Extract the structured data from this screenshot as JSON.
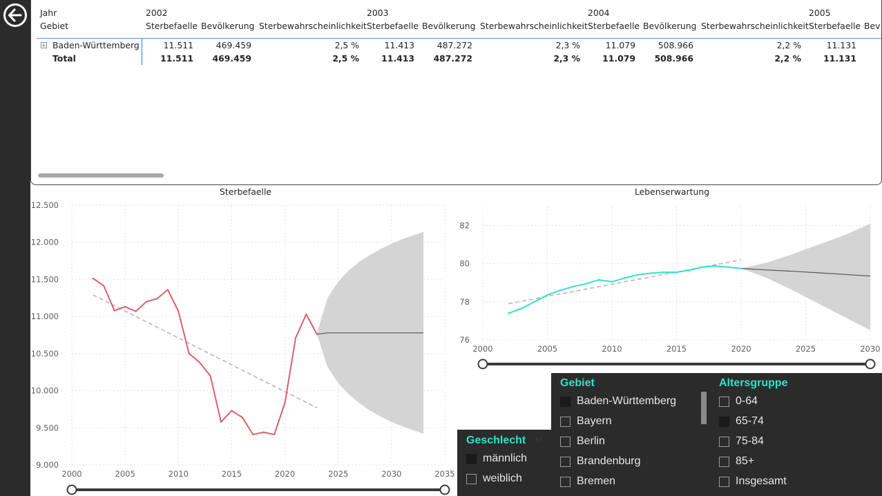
{
  "table": {
    "row_header_year": "Jahr",
    "row_header_area": "Gebiet",
    "years": [
      {
        "year": "2002",
        "cols": [
          "Sterbefaelle",
          "Bevölkerung",
          "Sterbewahrscheinlichkeit"
        ],
        "row": [
          "11.511",
          "469.459",
          "2,5 %"
        ],
        "total": [
          "11.511",
          "469.459",
          "2,5 %"
        ]
      },
      {
        "year": "2003",
        "cols": [
          "Sterbefaelle",
          "Bevölkerung",
          "Sterbewahrscheinlichkeit"
        ],
        "row": [
          "11.413",
          "487.272",
          "2,3 %"
        ],
        "total": [
          "11.413",
          "487.272",
          "2,3 %"
        ]
      },
      {
        "year": "2004",
        "cols": [
          "Sterbefaelle",
          "Bevölkerung",
          "Sterbewahrscheinlichkeit"
        ],
        "row": [
          "11.079",
          "508.966",
          "2,2 %"
        ],
        "total": [
          "11.079",
          "508.966",
          "2,2 %"
        ]
      },
      {
        "year": "2005",
        "cols": [
          "Sterbefaelle",
          "Bev"
        ],
        "row": [
          "11.131"
        ],
        "total": [
          "11.131"
        ]
      }
    ],
    "row_label": "Baden-Württemberg",
    "total_label": "Total"
  },
  "icons": {
    "back": "circle-arrow-left-icon",
    "expand": "plus-square-icon",
    "dropdown": "chevron-down-icon"
  },
  "chart_data": [
    {
      "type": "line",
      "title": "Sterbefaelle",
      "xlabel": "",
      "ylabel": "",
      "xlim": [
        2000,
        2035
      ],
      "ylim": [
        9000,
        12500
      ],
      "xticks": [
        2000,
        2005,
        2010,
        2015,
        2020,
        2025,
        2030,
        2035
      ],
      "xtick_labels": [
        "2000",
        "2005",
        "2010",
        "2015",
        "2020",
        "2025",
        "2030",
        "2035"
      ],
      "yticks": [
        9000,
        9500,
        10000,
        10500,
        11000,
        11500,
        12000,
        12500
      ],
      "ytick_labels": [
        "9.000",
        "9.500",
        "10.000",
        "10.500",
        "11.000",
        "11.500",
        "12.000",
        "12.500"
      ],
      "grid": true,
      "series": [
        {
          "color": "#d9606b",
          "x": [
            2002,
            2003,
            2004,
            2005,
            2006,
            2007,
            2008,
            2009,
            2010,
            2011,
            2012,
            2013,
            2014,
            2015,
            2016,
            2017,
            2018,
            2019,
            2020,
            2021,
            2022,
            2023
          ],
          "y": [
            11511,
            11413,
            11079,
            11131,
            11070,
            11200,
            11240,
            11360,
            11070,
            10500,
            10380,
            10200,
            9580,
            9730,
            9640,
            9410,
            9440,
            9410,
            9840,
            10710,
            11030,
            10760
          ]
        }
      ],
      "trend": {
        "color": "#bdbdbd",
        "x": [
          2002,
          2023
        ],
        "y": [
          11290,
          9770
        ]
      },
      "forecast": {
        "color": "#555555",
        "band_color": "#d4d4d4",
        "x": [
          2023,
          2024,
          2025,
          2026,
          2027,
          2028,
          2029,
          2030,
          2031,
          2032,
          2033
        ],
        "y": [
          10760,
          10780,
          10780,
          10780,
          10780,
          10780,
          10780,
          10780,
          10780,
          10780,
          10780
        ],
        "upper": [
          10780,
          11250,
          11470,
          11620,
          11740,
          11830,
          11910,
          11980,
          12040,
          12090,
          12140
        ],
        "lower": [
          10760,
          10320,
          10100,
          9950,
          9830,
          9730,
          9650,
          9580,
          9520,
          9470,
          9420
        ]
      },
      "slider": {
        "from": 2000,
        "to": 2035
      }
    },
    {
      "type": "line",
      "title": "Lebenserwartung",
      "xlabel": "",
      "ylabel": "",
      "xlim": [
        2000,
        2030
      ],
      "ylim": [
        76,
        83
      ],
      "xticks": [
        2000,
        2005,
        2010,
        2015,
        2020,
        2025,
        2030
      ],
      "xtick_labels": [
        "2000",
        "2005",
        "2010",
        "2015",
        "2020",
        "2025",
        "2030"
      ],
      "yticks": [
        76,
        78,
        80,
        82
      ],
      "ytick_labels": [
        "76",
        "78",
        "80",
        "82"
      ],
      "grid": true,
      "series": [
        {
          "color": "#2fe3c6",
          "x": [
            2002,
            2003,
            2004,
            2005,
            2006,
            2007,
            2008,
            2009,
            2010,
            2011,
            2012,
            2013,
            2014,
            2015,
            2016,
            2017,
            2018,
            2019,
            2020
          ],
          "y": [
            77.4,
            77.65,
            78.0,
            78.35,
            78.6,
            78.8,
            78.95,
            79.15,
            79.05,
            79.25,
            79.42,
            79.5,
            79.55,
            79.55,
            79.66,
            79.82,
            79.88,
            79.82,
            79.75
          ]
        }
      ],
      "trend": {
        "color": "#bdbdbd",
        "x": [
          2002,
          2020
        ],
        "y": [
          77.9,
          80.2
        ]
      },
      "forecast": {
        "color": "#555555",
        "band_color": "#d4d4d4",
        "x": [
          2020,
          2022,
          2024,
          2026,
          2028,
          2030
        ],
        "y": [
          79.75,
          79.67,
          79.6,
          79.52,
          79.44,
          79.35
        ],
        "upper": [
          79.75,
          80.05,
          80.5,
          81.0,
          81.5,
          82.1
        ],
        "lower": [
          79.75,
          79.25,
          78.6,
          77.9,
          77.2,
          76.5
        ]
      },
      "slider": {
        "from": 2000,
        "to": 2030
      }
    }
  ],
  "slicers": {
    "geschlecht": {
      "title": "Geschlecht",
      "items": [
        {
          "label": "männlich",
          "checked": true
        },
        {
          "label": "weiblich",
          "checked": false
        }
      ]
    },
    "gebiet": {
      "title": "Gebiet",
      "items": [
        {
          "label": "Baden-Württemberg",
          "checked": true
        },
        {
          "label": "Bayern",
          "checked": false
        },
        {
          "label": "Berlin",
          "checked": false
        },
        {
          "label": "Brandenburg",
          "checked": false
        },
        {
          "label": "Bremen",
          "checked": false
        }
      ]
    },
    "altersgruppe": {
      "title": "Altersgruppe",
      "items": [
        {
          "label": "0-64",
          "checked": false
        },
        {
          "label": "65-74",
          "checked": true
        },
        {
          "label": "75-84",
          "checked": false
        },
        {
          "label": "85+",
          "checked": false
        },
        {
          "label": "Insgesamt",
          "checked": false
        }
      ]
    }
  },
  "colors": {
    "accent": "#2fe3c6",
    "panel_dark": "#2b2b2b",
    "table_rule": "#2c7bd6"
  }
}
